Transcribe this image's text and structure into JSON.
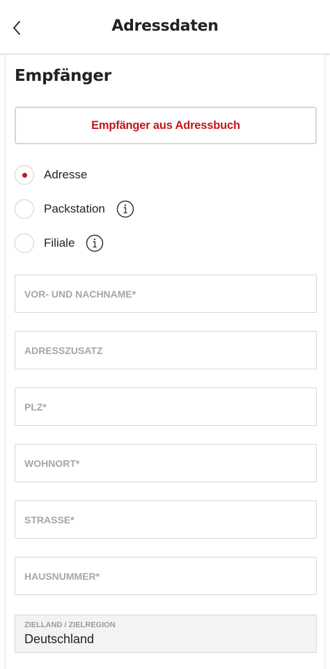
{
  "header": {
    "title": "Adressdaten",
    "back_icon": "chevron-left-icon"
  },
  "recipient": {
    "section_title": "Empfänger",
    "addressbook_button": "Empfänger aus Adressbuch",
    "delivery_options": [
      {
        "label": "Adresse",
        "selected": true,
        "info": false
      },
      {
        "label": "Packstation",
        "selected": false,
        "info": true
      },
      {
        "label": "Filiale",
        "selected": false,
        "info": true
      }
    ],
    "fields": {
      "name": {
        "placeholder": "VOR- UND NACHNAME*",
        "value": ""
      },
      "address_extra": {
        "placeholder": "ADRESSZUSATZ",
        "value": ""
      },
      "zip": {
        "placeholder": "PLZ*",
        "value": ""
      },
      "city": {
        "placeholder": "WOHNORT*",
        "value": ""
      },
      "street": {
        "placeholder": "STRASSE*",
        "value": ""
      },
      "house_number": {
        "placeholder": "HAUSNUMMER*",
        "value": ""
      }
    },
    "destination": {
      "label": "ZIELLAND / ZIELREGION",
      "value": "Deutschland"
    }
  },
  "colors": {
    "accent": "#c4161c",
    "border": "#d6d6d6",
    "placeholder": "#a6a6a6"
  }
}
